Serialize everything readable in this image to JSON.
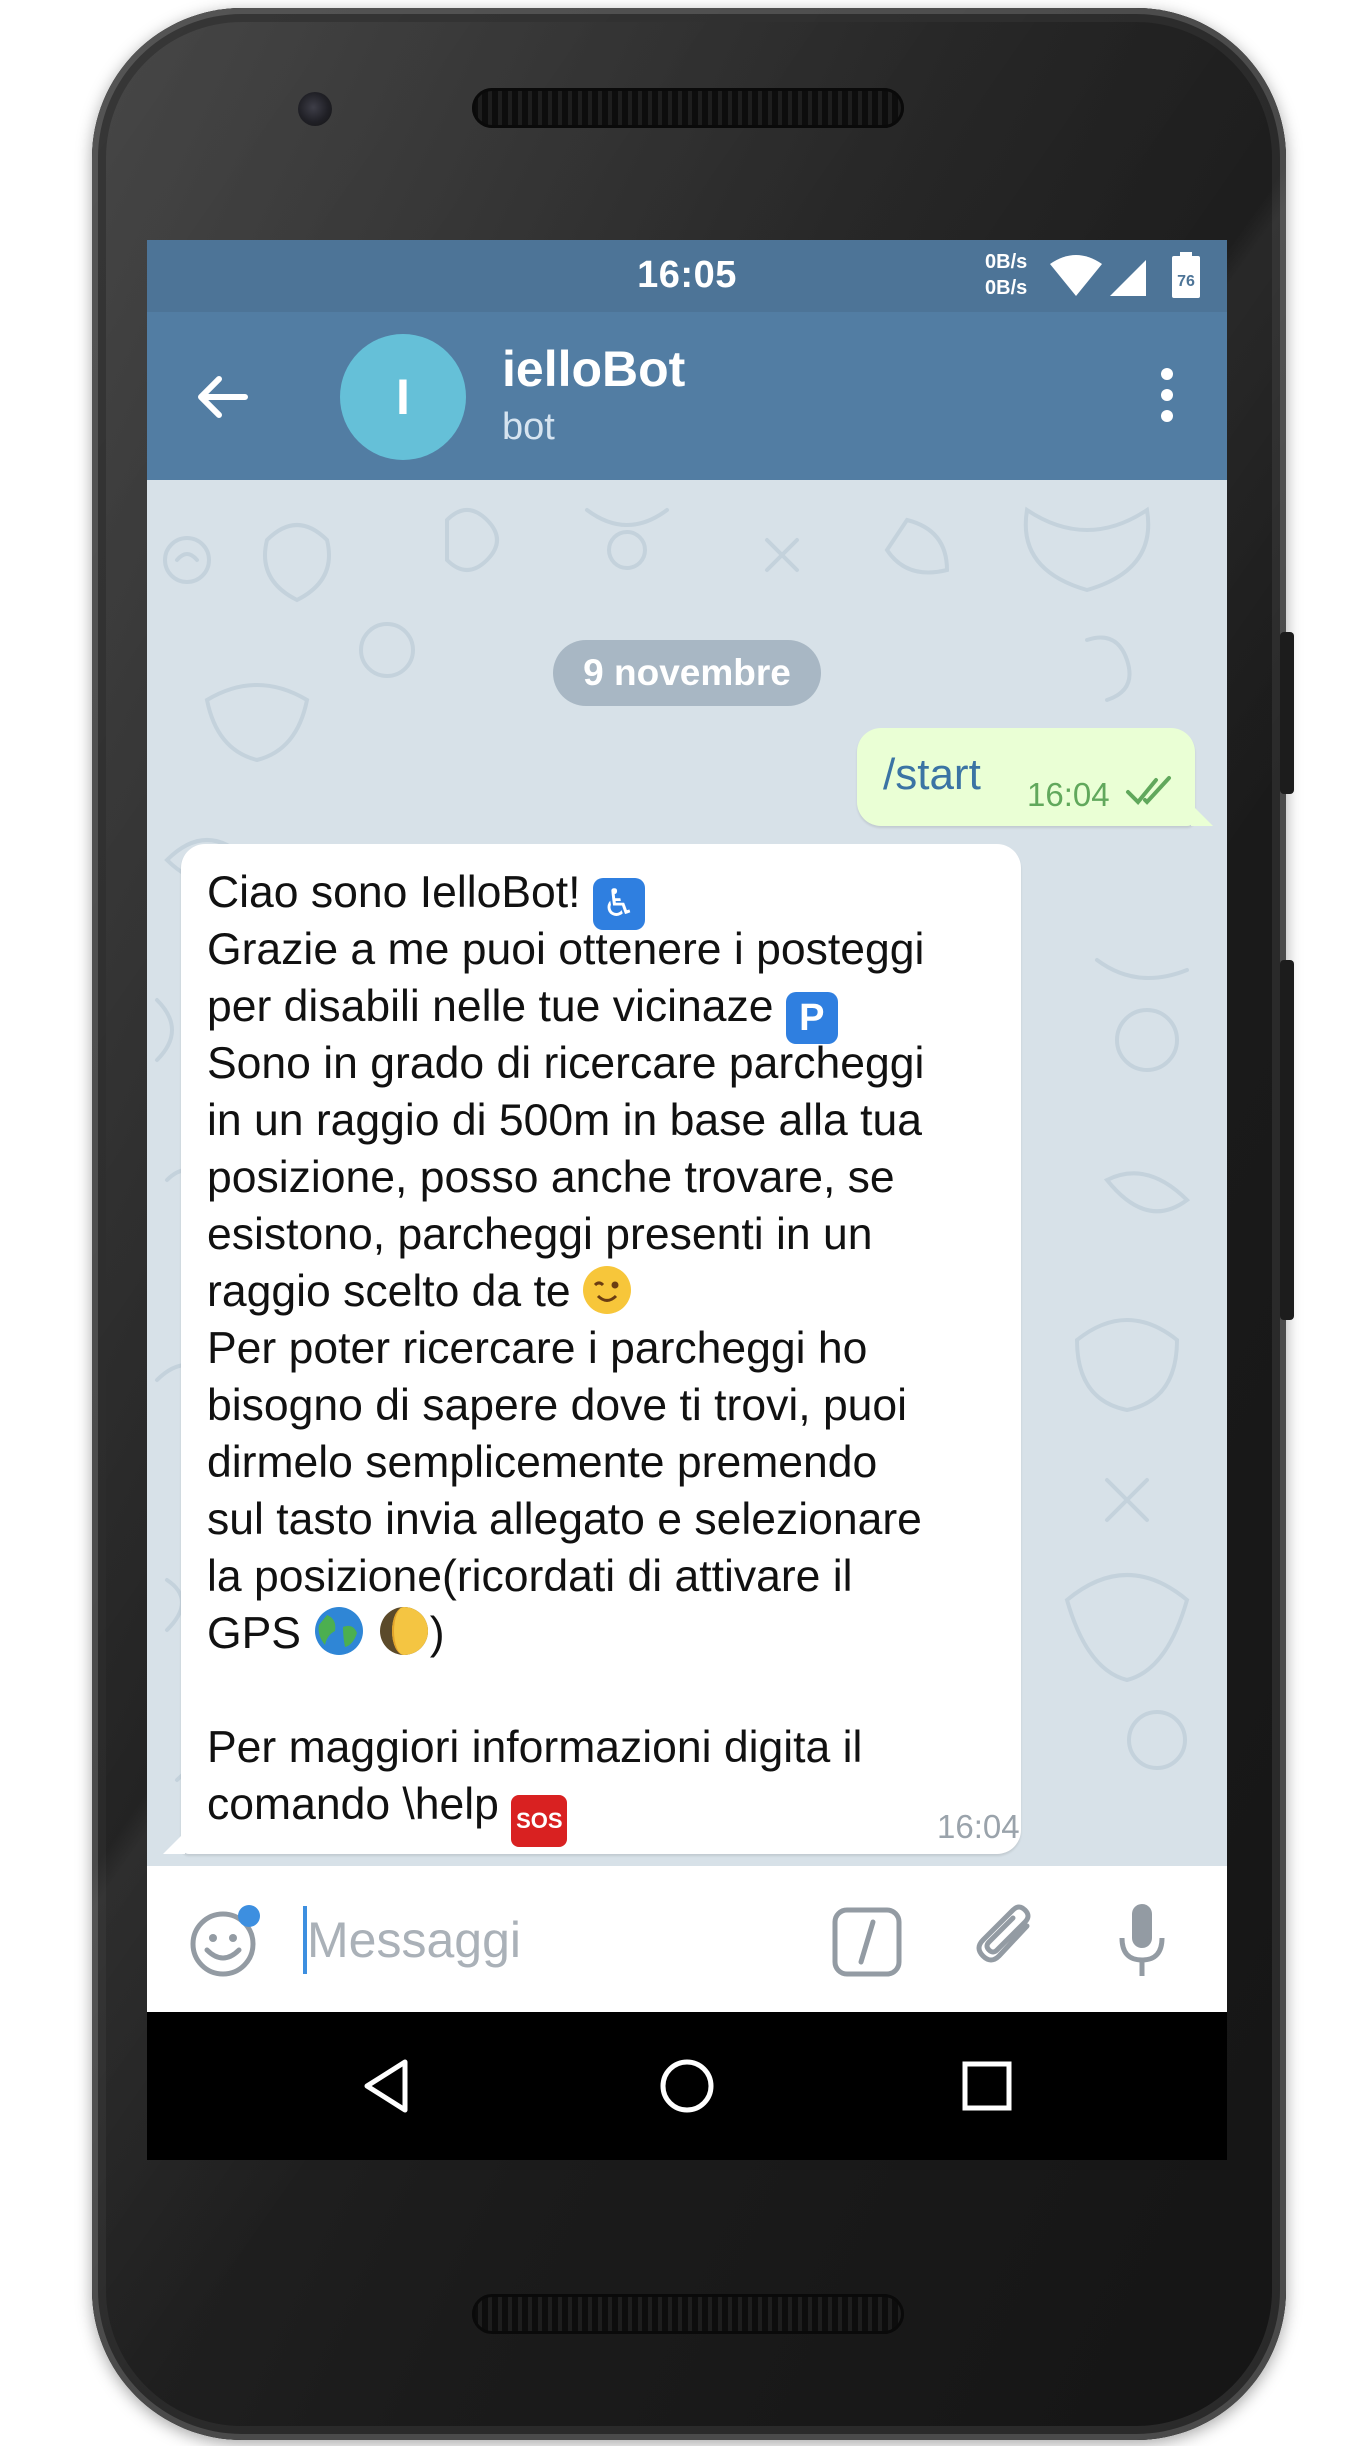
{
  "status_bar": {
    "time": "16:05",
    "net_up": "0B/s",
    "net_down": "0B/s",
    "battery_level": "76"
  },
  "header": {
    "avatar_letter": "I",
    "chat_title": "ielloBot",
    "chat_subtitle": "bot"
  },
  "chat": {
    "date_separator": "9 novembre",
    "outgoing": {
      "text": "/start",
      "time": "16:04",
      "status": "read"
    },
    "incoming": {
      "lines": [
        "Ciao sono IelloBot!",
        "Grazie a me puoi ottenere i posteggi",
        "per disabili nelle tue vicinaze",
        "Sono in grado di ricercare parcheggi",
        "in un raggio di 500m in base alla tua",
        "posizione, posso anche trovare, se",
        "esistono, parcheggi presenti in un",
        "raggio scelto da te",
        "Per poter ricercare i parcheggi ho",
        "bisogno di sapere dove ti trovi, puoi",
        "dirmelo semplicemente premendo",
        "sul tasto invia allegato e selezionare",
        "la posizione(ricordati di attivare il",
        "GPS",
        ")",
        "",
        "Per maggiori informazioni digita il",
        "comando \\help"
      ],
      "emoji": {
        "wheelchair": "♿",
        "parking": "P",
        "wink": "😉",
        "sos": "SOS"
      },
      "time": "16:04"
    }
  },
  "composer": {
    "placeholder": "Messaggi",
    "value": ""
  },
  "colors": {
    "statusbar": "#4d7497",
    "appbar": "#527da3",
    "avatar": "#65c0d8",
    "outgoing_bubble": "#eaffd5",
    "incoming_bubble": "#ffffff",
    "outgoing_text": "#3b74a4",
    "outgoing_time": "#61a85c"
  }
}
